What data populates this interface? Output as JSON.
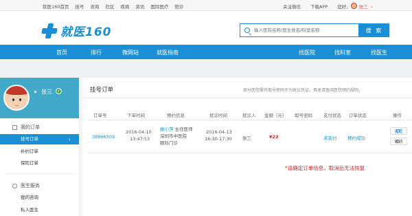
{
  "topbar": {
    "links": [
      "就医160首页",
      "挂号",
      "咨询",
      "社区",
      "疾病",
      "资讯",
      "国际医疗",
      "陪诊"
    ],
    "follow": "关注微信",
    "download": "下载APP",
    "greeting": "您好，",
    "username": "张三"
  },
  "header": {
    "logo_text": "就医160",
    "search_placeholder": "输入医院名称/医生姓名/科室名称",
    "search_button": "搜 索"
  },
  "nav": {
    "left": [
      "首页",
      "排行",
      "微网站",
      "就医指南"
    ],
    "right": [
      "找医院",
      "找科室",
      "找医生"
    ]
  },
  "sidebar": {
    "profile_name": "张三",
    "section_orders": "我的订单",
    "order_items": [
      "挂号订单",
      "补约订单",
      "保险订单"
    ],
    "section_services": "医生服务",
    "service_items": [
      "我的咨询",
      "私人医生"
    ]
  },
  "main": {
    "title": "挂号订单",
    "note": "部分医院需凭取号密码作为就诊凭证，具体请查阅医院预约规则。",
    "columns": [
      "订单号",
      "下单时间",
      "预约信息",
      "就诊时间",
      "就诊人",
      "金额（元）",
      "取号密码",
      "支付状态",
      "订单状态",
      "操作"
    ],
    "order": {
      "id": "38866509",
      "order_date": "2016-04-10",
      "order_time": "13:47:53",
      "doctor": "姚小萍",
      "doctor_title": "主任医师",
      "hospital": "深圳市中医院",
      "department": "眼科门诊",
      "visit_date": "2016-04-13",
      "visit_time": "16:30-17:30",
      "patient": "张三",
      "amount": "¥23",
      "pay_status": "未支付",
      "order_status": "预约成功",
      "view": "查看",
      "cancel": "取消"
    },
    "warning": "*请确定订单信息，取消后无法恢复"
  },
  "colors": {
    "brand_blue": "#1a8fd6",
    "profile_bg": "#43a9c9",
    "alert_red": "#e02020"
  }
}
